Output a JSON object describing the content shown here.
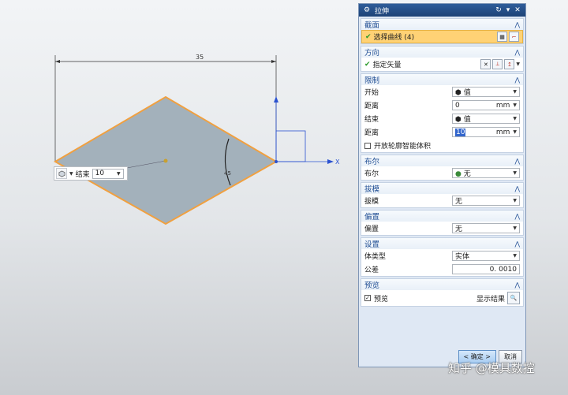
{
  "viewport": {
    "dimension_top": "35",
    "angle_label": "45",
    "axis_label": "X",
    "mini_toolbar": {
      "label": "结束",
      "value": "10"
    }
  },
  "dialog": {
    "title": "拉伸",
    "section_profile": {
      "title": "截面",
      "select_label": "选择曲线 (4)"
    },
    "section_direction": {
      "title": "方向",
      "vector_label": "指定矢量"
    },
    "section_limits": {
      "title": "限制",
      "start_label": "开始",
      "start_value": "值",
      "start_dist_label": "距离",
      "start_dist_value": "0",
      "start_dist_unit": "mm",
      "end_label": "结束",
      "end_value": "值",
      "end_dist_label": "距离",
      "end_dist_value": "10",
      "end_dist_unit": "mm",
      "open_profile_label": "开放轮廓智能体积"
    },
    "section_boolean": {
      "title": "布尔",
      "label": "布尔",
      "value": "无"
    },
    "section_draft": {
      "title": "拔模",
      "label": "拔模",
      "value": "无"
    },
    "section_offset": {
      "title": "偏置",
      "label": "偏置",
      "value": "无"
    },
    "section_settings": {
      "title": "设置",
      "body_type_label": "体类型",
      "body_type_value": "实体",
      "tolerance_label": "公差",
      "tolerance_value": "0. 0010"
    },
    "section_preview": {
      "title": "预览",
      "preview_label": "预览",
      "show_result_label": "显示结果"
    },
    "ok_label": "< 确定 >",
    "cancel_label": "取消"
  },
  "watermark": "知乎 @模具数控",
  "colors": {
    "sketch_fill": "#a3b1bb",
    "sketch_edge": "#f0a040",
    "title_bar": "#254f8a",
    "highlight": "#ffd275"
  }
}
